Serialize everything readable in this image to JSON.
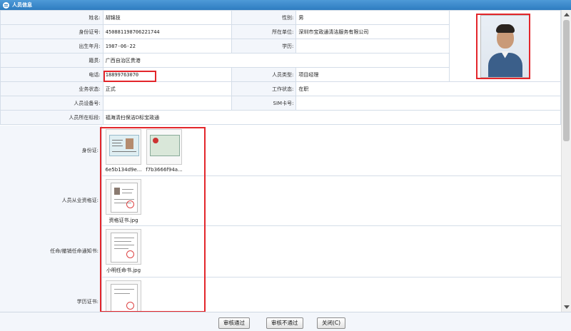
{
  "window": {
    "title": "人员信息"
  },
  "fields": {
    "name_label": "姓名:",
    "name": "胡锦技",
    "gender_label": "性别:",
    "gender": "男",
    "id_label": "身份证号:",
    "id_number": "450881198706221744",
    "unit_label": "所在单位:",
    "unit": "深圳市宝政通清洁服务有限公司",
    "birth_label": "出生年月:",
    "birth": "1987-06-22",
    "edu_label": "学历:",
    "edu": "",
    "origin_label": "籍贯:",
    "origin": "广西自治区贵港",
    "phone_label": "电话:",
    "phone": "18899763070",
    "type_label": "人员类型:",
    "type": "项目经理",
    "biz_status_label": "业务状态:",
    "biz_status": "正式",
    "work_status_label": "工作状态:",
    "work_status": "在职",
    "device_label": "人员设备号:",
    "device": "",
    "sim_label": "SIM卡号:",
    "sim": "",
    "section_label": "人员所在标段:",
    "section": "福海清扫保洁D标宝政通"
  },
  "documents": {
    "id_card_label": "身份证:",
    "id_card_files": [
      "6e5b134d9e...",
      "f7b3666f94a..."
    ],
    "qual_label": "人员从业资格证:",
    "qual_files": [
      "资格证书.jpg"
    ],
    "appoint_label": "任命/撤销任命通知书:",
    "appoint_files": [
      "小明任命书.jpg"
    ],
    "edu_cert_label": "学历证书:"
  },
  "buttons": {
    "approve": "审核通过",
    "reject": "审核不通过",
    "close": "关闭(C)"
  }
}
